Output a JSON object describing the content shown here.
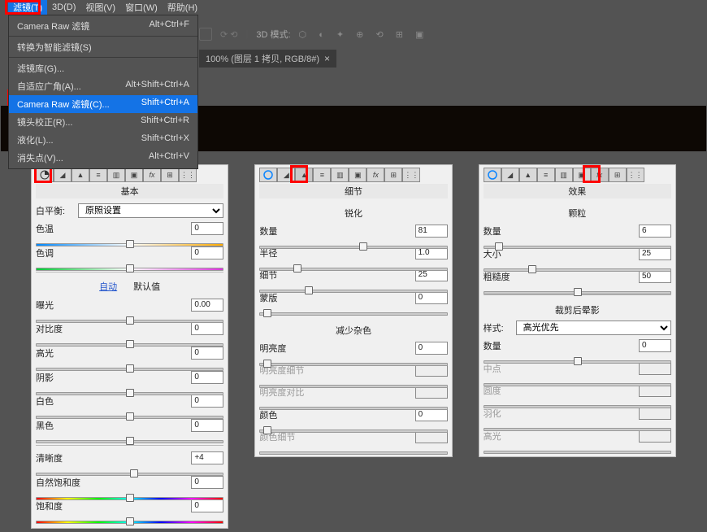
{
  "menu": {
    "items": [
      "滤镜(T)",
      "3D(D)",
      "视图(V)",
      "窗口(W)",
      "帮助(H)"
    ]
  },
  "dropdown": [
    {
      "label": "Camera Raw 滤镜",
      "sc": "Alt+Ctrl+F",
      "sep": true
    },
    {
      "label": "转换为智能滤镜(S)",
      "sc": "",
      "sep": true
    },
    {
      "label": "滤镜库(G)...",
      "sc": ""
    },
    {
      "label": "自适应广角(A)...",
      "sc": "Alt+Shift+Ctrl+A"
    },
    {
      "label": "Camera Raw 滤镜(C)...",
      "sc": "Shift+Ctrl+A",
      "hl": true
    },
    {
      "label": "镜头校正(R)...",
      "sc": "Shift+Ctrl+R"
    },
    {
      "label": "液化(L)...",
      "sc": "Shift+Ctrl+X"
    },
    {
      "label": "消失点(V)...",
      "sc": "Alt+Ctrl+V"
    }
  ],
  "toolbar": {
    "mode_label": "3D 模式:"
  },
  "tab": {
    "title": "100% (图层 1 拷贝, RGB/8#)"
  },
  "p1": {
    "title": "基本",
    "wb_label": "白平衡:",
    "wb_value": "原照设置",
    "temp": "色温",
    "temp_v": "0",
    "tint": "色调",
    "tint_v": "0",
    "auto": "自动",
    "default": "默认值",
    "exposure": "曝光",
    "exposure_v": "0.00",
    "contrast": "对比度",
    "contrast_v": "0",
    "highlights": "高光",
    "highlights_v": "0",
    "shadows": "阴影",
    "shadows_v": "0",
    "whites": "白色",
    "whites_v": "0",
    "blacks": "黑色",
    "blacks_v": "0",
    "clarity": "清晰度",
    "clarity_v": "+4",
    "vibrance": "自然饱和度",
    "vibrance_v": "0",
    "sat": "饱和度",
    "sat_v": "0"
  },
  "p2": {
    "title": "细节",
    "sharp": "锐化",
    "amount": "数量",
    "amount_v": "81",
    "radius": "半径",
    "radius_v": "1.0",
    "detail": "细节",
    "detail_v": "25",
    "mask": "蒙版",
    "mask_v": "0",
    "nr": "减少杂色",
    "lum": "明亮度",
    "lum_v": "0",
    "lumd": "明亮度细节",
    "lumc": "明亮度对比",
    "color": "颜色",
    "color_v": "0",
    "cold": "颜色细节"
  },
  "p3": {
    "title": "效果",
    "grain": "颗粒",
    "gamount": "数量",
    "gamount_v": "6",
    "gsize": "大小",
    "gsize_v": "25",
    "grough": "粗糙度",
    "grough_v": "50",
    "vig": "裁剪后晕影",
    "style": "样式:",
    "style_v": "高光优先",
    "vamount": "数量",
    "vamount_v": "0",
    "mid": "中点",
    "round": "圆度",
    "feather": "羽化",
    "hl": "高光"
  }
}
